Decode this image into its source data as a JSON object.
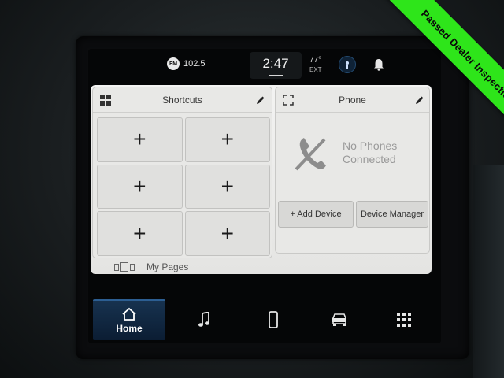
{
  "status_bar": {
    "radio_band": "FM",
    "radio_station": "102.5",
    "time": "2:47",
    "temperature": "77°",
    "temperature_label": "EXT"
  },
  "shortcuts": {
    "title": "Shortcuts",
    "tiles": [
      "+",
      "+",
      "+",
      "+",
      "+",
      "+"
    ],
    "my_pages_label": "My Pages"
  },
  "phone": {
    "title": "Phone",
    "message_line1": "No Phones",
    "message_line2": "Connected",
    "add_device_label": "+ Add Device",
    "device_manager_label": "Device Manager"
  },
  "nav": {
    "home_label": "Home",
    "active": "home"
  },
  "banner": {
    "text": "Passed Dealer Inspection",
    "color": "#2ee51a"
  },
  "colors": {
    "accent": "#17324f",
    "panel_bg": "#e8e8e6"
  }
}
